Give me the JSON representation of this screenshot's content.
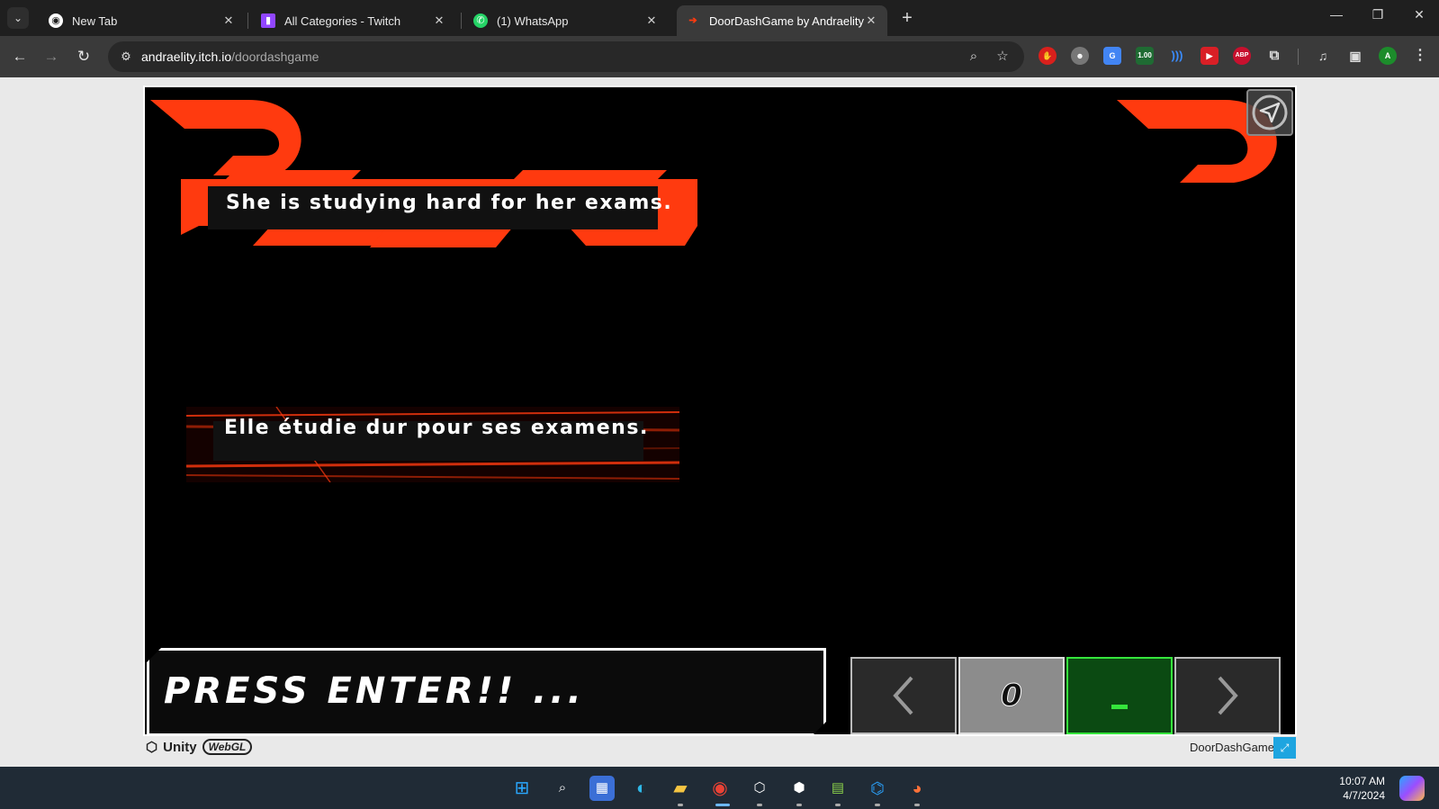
{
  "tabs": [
    {
      "title": "New Tab",
      "icon": "chrome-icon"
    },
    {
      "title": "All Categories - Twitch",
      "icon": "twitch-icon"
    },
    {
      "title": "(1) WhatsApp",
      "icon": "whatsapp-icon"
    },
    {
      "title": "DoorDashGame by Andraelity",
      "icon": "doordash-icon",
      "active": true
    }
  ],
  "address": {
    "domain": "andraelity.itch.io",
    "path": "/doordashgame"
  },
  "extensions": {
    "counter_badge": "1.00",
    "adblock": "ABP"
  },
  "game": {
    "english_sentence": "She is studying hard for her exams.",
    "french_sentence": "Elle étudie dur pour ses examens.",
    "prompt": "PRESS ENTER!! ...",
    "score": "0",
    "accent_color": "#ff3a0f",
    "success_color": "#35e53c"
  },
  "footer": {
    "engine": "Unity",
    "platform": "WebGL",
    "game_title": "DoorDashGame"
  },
  "taskbar": {
    "time": "10:07 AM",
    "date": "4/7/2024"
  }
}
